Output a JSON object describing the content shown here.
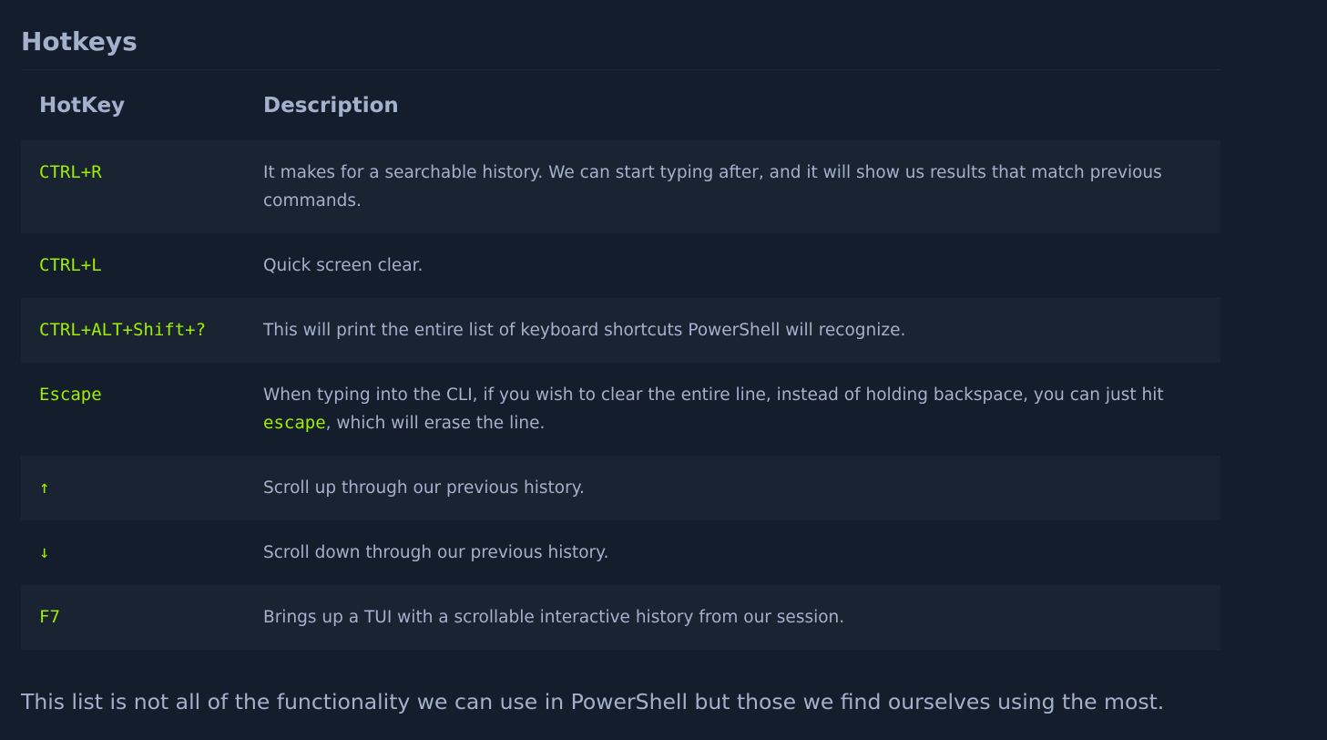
{
  "section": {
    "title": "Hotkeys"
  },
  "table": {
    "headers": {
      "hotkey": "HotKey",
      "description": "Description"
    },
    "rows": [
      {
        "key": "CTRL+R",
        "description": "It makes for a searchable history. We can start typing after, and it will show us results that match previous commands."
      },
      {
        "key": "CTRL+L",
        "description": "Quick screen clear."
      },
      {
        "key": "CTRL+ALT+Shift+?",
        "description": "This will print the entire list of keyboard shortcuts PowerShell will recognize."
      },
      {
        "key": "Escape",
        "description_before": "When typing into the CLI, if you wish to clear the entire line, instead of holding backspace, you can just hit ",
        "description_code": "escape",
        "description_after": ", which will erase the line."
      },
      {
        "key": "↑",
        "description": "Scroll up through our previous history."
      },
      {
        "key": "↓",
        "description": "Scroll down through our previous history."
      },
      {
        "key": "F7",
        "description": "Brings up a TUI with a scrollable interactive history from our session."
      }
    ]
  },
  "footer": {
    "text": "This list is not all of the functionality we can use in PowerShell but those we find ourselves using the most."
  },
  "colors": {
    "background": "#141d2b",
    "row_alt": "#1a2332",
    "text": "#a4b1cd",
    "accent": "#9fef00"
  }
}
